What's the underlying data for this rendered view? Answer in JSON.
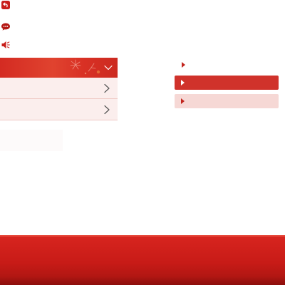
{
  "toolbar": {
    "icons": [
      "back-icon",
      "chat-icon",
      "speaker-icon"
    ]
  },
  "accordion": {
    "header_icon": "chevron-down-icon",
    "row_icon": "chevron-right-icon",
    "rows": 2
  },
  "options": {
    "items": [
      {
        "state": "plain"
      },
      {
        "state": "selected"
      },
      {
        "state": "hover"
      }
    ],
    "marker_icon": "triangle-right-icon"
  },
  "colors": {
    "accent": "#d0322b",
    "accent_dark": "#a41410",
    "header_red": "#d42b22",
    "row_tint": "#fbeeed",
    "row_border": "#efc8c4",
    "soft_bar": "#f6d8d5",
    "icon_red": "#c2251d"
  }
}
